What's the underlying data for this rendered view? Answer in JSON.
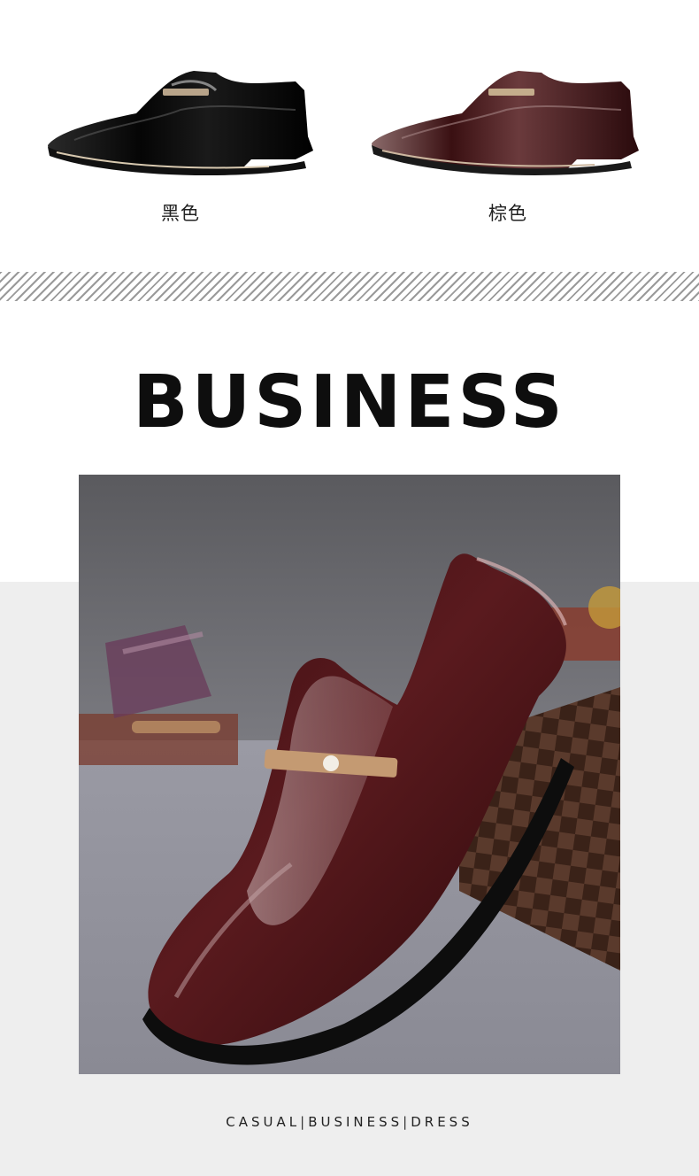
{
  "variants": [
    {
      "label": "黑色",
      "color": "#0b0b0b"
    },
    {
      "label": "棕色",
      "color": "#4a1619"
    }
  ],
  "banner": {
    "title": "BUSINESS"
  },
  "hero": {
    "shoe_color": "#5a1a1e",
    "floor_color": "#8c8c98",
    "wall_color": "#6d6d72"
  },
  "tagline": {
    "items": [
      "CASUAL",
      "BUSINESS",
      "DRESS"
    ],
    "separator": "|"
  },
  "colors": {
    "background": "#ffffff",
    "gray_band": "#eeeeee",
    "text": "#0e0e0e"
  }
}
